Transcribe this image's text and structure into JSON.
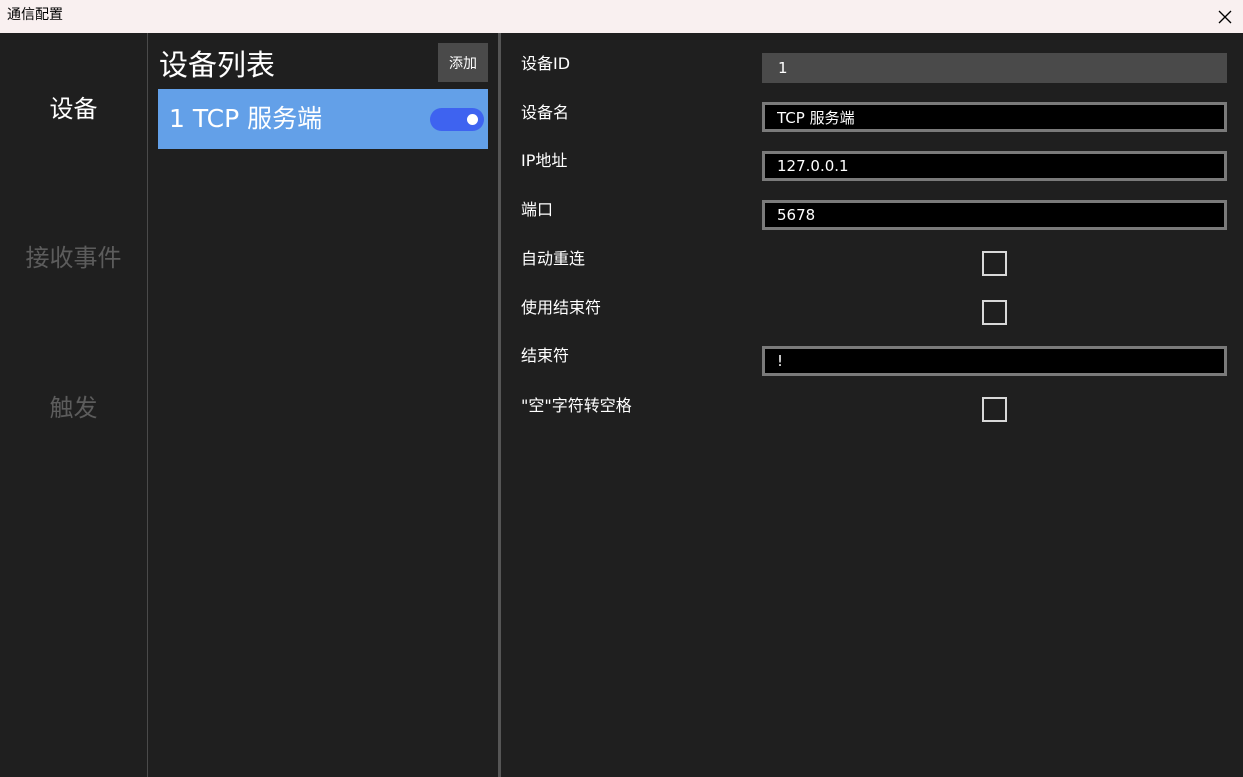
{
  "window": {
    "title": "通信配置"
  },
  "nav": {
    "items": [
      {
        "label": "设备",
        "state": "active"
      },
      {
        "label": "接收事件",
        "state": "inactive"
      },
      {
        "label": "触发",
        "state": "inactive"
      }
    ]
  },
  "device_list": {
    "title": "设备列表",
    "add_label": "添加",
    "items": [
      {
        "label": "1 TCP 服务端",
        "enabled": true
      }
    ]
  },
  "form": {
    "device_id": {
      "label": "设备ID",
      "value": "1"
    },
    "device_name": {
      "label": "设备名",
      "value": "TCP 服务端"
    },
    "ip_address": {
      "label": "IP地址",
      "value": "127.0.0.1"
    },
    "port": {
      "label": "端口",
      "value": "5678"
    },
    "auto_reconnect": {
      "label": "自动重连",
      "checked": false
    },
    "use_terminator": {
      "label": "使用结束符",
      "checked": false
    },
    "terminator": {
      "label": "结束符",
      "value": "!"
    },
    "null_to_space": {
      "label": "\"空\"字符转空格",
      "checked": false
    }
  },
  "colors": {
    "background": "#1f1f1f",
    "selected_item": "#63a0e8",
    "toggle_on": "#3e63f0",
    "titlebar": "#f9f0f0"
  }
}
